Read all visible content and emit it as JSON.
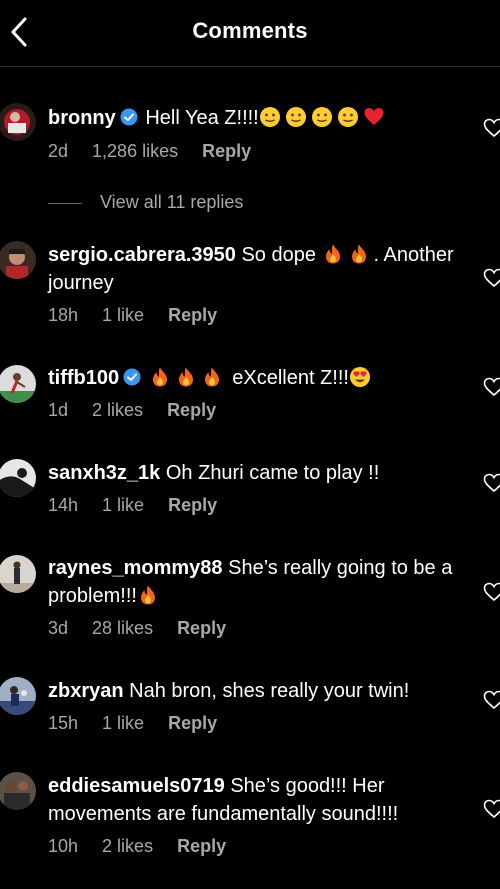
{
  "header": {
    "title": "Comments"
  },
  "comments": [
    {
      "username": "bronny",
      "verified": true,
      "text": "Hell Yea Z!!!!",
      "emojis": [
        "slight-smile",
        "slight-smile",
        "slight-smile",
        "slight-smile",
        "red-heart"
      ],
      "age": "2d",
      "likes": "1,286 likes",
      "reply": "Reply",
      "view_replies": "View all 11 replies"
    },
    {
      "username": "sergio.cabrera.3950",
      "text": "So dope",
      "emojis": [
        "fire",
        "fire"
      ],
      "text_after": ". Another journey",
      "age": "18h",
      "likes": "1 like",
      "reply": "Reply"
    },
    {
      "username": "tiffb100",
      "verified": true,
      "text": "",
      "emojis": [
        "fire",
        "fire",
        "fire"
      ],
      "text_after": " eXcellent Z!!!",
      "emojis_after": [
        "heart-eyes"
      ],
      "age": "1d",
      "likes": "2 likes",
      "reply": "Reply"
    },
    {
      "username": "sanxh3z_1k",
      "text": "Oh Zhuri came to play !!",
      "age": "14h",
      "likes": "1 like",
      "reply": "Reply"
    },
    {
      "username": "raynes_mommy88",
      "text": "She’s really going to be a problem!!!",
      "emojis": [
        "fire"
      ],
      "age": "3d",
      "likes": "28 likes",
      "reply": "Reply"
    },
    {
      "username": "zbxryan",
      "text": "Nah bron, shes really your twin!",
      "age": "15h",
      "likes": "1 like",
      "reply": "Reply"
    },
    {
      "username": "eddiesamuels0719",
      "text": "She’s good!!! Her movements are fundamentally sound!!!!",
      "age": "10h",
      "likes": "2 likes",
      "reply": "Reply"
    }
  ],
  "colors": {
    "background": "#000000",
    "secondary_text": "#a8a8a8",
    "verified_badge": "#3897f0",
    "divider": "#2f2f2f"
  }
}
